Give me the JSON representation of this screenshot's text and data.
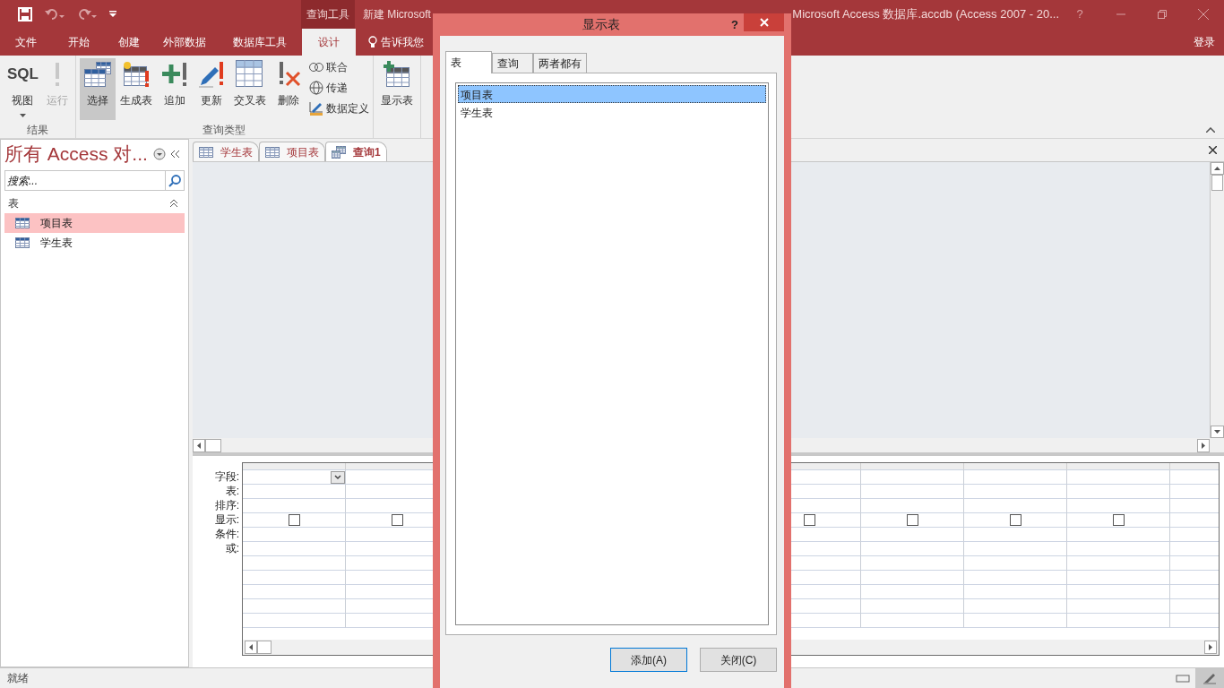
{
  "title_bar": {
    "contextual_label": "查询工具",
    "title_left": "新建 Microsoft",
    "title_right": "Microsoft Access 数据库.accdb (Access 2007 - 20...",
    "help": "?"
  },
  "ribbon_tabs": [
    {
      "label": "文件",
      "selected": false
    },
    {
      "label": "开始",
      "selected": false
    },
    {
      "label": "创建",
      "selected": false
    },
    {
      "label": "外部数据",
      "selected": false
    },
    {
      "label": "数据库工具",
      "selected": false
    },
    {
      "label": "设计",
      "selected": true
    }
  ],
  "tell_me": "告诉我您",
  "sign_in": "登录",
  "ribbon": {
    "groups": [
      {
        "label": "结果",
        "buttons": [
          {
            "kind": "sql",
            "icon_text": "SQL",
            "label": "视图",
            "disabled": false,
            "selected": false
          },
          {
            "kind": "run",
            "label": "运行",
            "disabled": true,
            "selected": false
          }
        ]
      },
      {
        "label": "查询类型",
        "buttons": [
          {
            "kind": "select",
            "label": "选择",
            "disabled": false,
            "selected": true
          },
          {
            "kind": "make",
            "label": "生成表",
            "disabled": false,
            "selected": false
          },
          {
            "kind": "append",
            "label": "追加",
            "disabled": false,
            "selected": false
          },
          {
            "kind": "update",
            "label": "更新",
            "disabled": false,
            "selected": false
          },
          {
            "kind": "crosstab",
            "label": "交叉表",
            "disabled": false,
            "selected": false
          },
          {
            "kind": "delete",
            "label": "删除",
            "disabled": false,
            "selected": false
          }
        ],
        "small_buttons": [
          {
            "kind": "union",
            "label": "联合"
          },
          {
            "kind": "pass",
            "label": "传递"
          },
          {
            "kind": "define",
            "label": "数据定义"
          }
        ]
      },
      {
        "buttons": [
          {
            "kind": "show",
            "label": "显示表",
            "disabled": false,
            "selected": false
          }
        ]
      }
    ]
  },
  "nav_pane": {
    "title": "所有 Access 对...",
    "search_placeholder": "搜索...",
    "section": "表",
    "items": [
      {
        "label": "项目表",
        "selected": true
      },
      {
        "label": "学生表",
        "selected": false
      }
    ]
  },
  "doc_tabs": [
    {
      "label": "学生表",
      "kind": "table",
      "selected": false
    },
    {
      "label": "项目表",
      "kind": "table",
      "selected": false
    },
    {
      "label": "查询1",
      "kind": "query",
      "selected": true
    }
  ],
  "query_grid": {
    "row_labels": [
      "字段:",
      "表:",
      "排序:",
      "显示:",
      "条件:",
      "或:"
    ],
    "display_checkboxes": [
      {
        "checked": false
      },
      {
        "checked": false
      },
      {
        "checked": false
      },
      {
        "checked": false
      },
      {
        "checked": false
      },
      {
        "checked": false
      }
    ]
  },
  "status_bar": {
    "text": "就绪"
  },
  "dialog": {
    "title": "显示表",
    "help": "?",
    "tabs": [
      {
        "label": "表",
        "selected": true
      },
      {
        "label": "查询",
        "selected": false
      },
      {
        "label": "两者都有",
        "selected": false
      }
    ],
    "items": [
      {
        "label": "项目表",
        "selected": true
      },
      {
        "label": "学生表",
        "selected": false
      }
    ],
    "buttons": [
      "添加(A)",
      "关闭(C)"
    ]
  }
}
